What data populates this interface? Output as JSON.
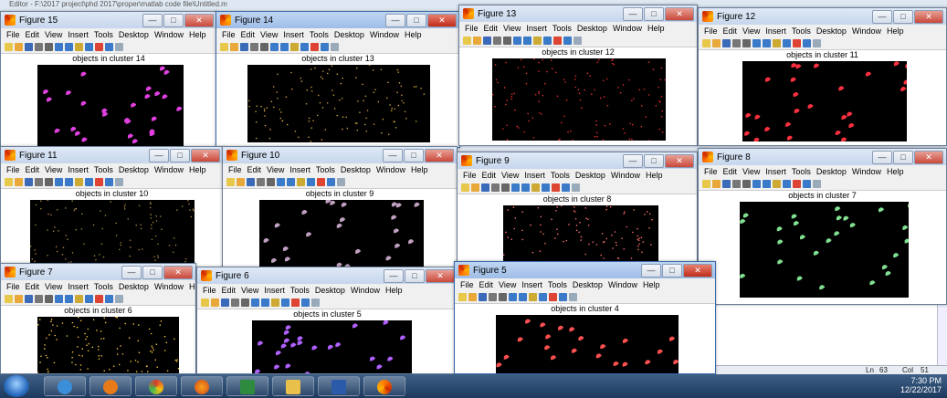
{
  "editor": {
    "title": "Editor - F:\\2017 project\\phd 2017\\proper\\matlab code file\\Untitled.m"
  },
  "menu": [
    "File",
    "Edit",
    "View",
    "Insert",
    "Tools",
    "Desktop",
    "Window",
    "Help"
  ],
  "figures": [
    {
      "title": "Figure 15",
      "plot_title": "objects in cluster 14",
      "dot": "#e040e0"
    },
    {
      "title": "Figure 14",
      "plot_title": "objects in cluster 13",
      "dot": "#c8a040"
    },
    {
      "title": "Figure 13",
      "plot_title": "objects in cluster 12",
      "dot": "#e03030"
    },
    {
      "title": "Figure 12",
      "plot_title": "objects in cluster 11",
      "dot": "#ff3040"
    },
    {
      "title": "Figure 11",
      "plot_title": "objects in cluster 10",
      "dot": "#a08040"
    },
    {
      "title": "Figure 10",
      "plot_title": "objects in cluster 9",
      "dot": "#c0a0c0"
    },
    {
      "title": "Figure 9",
      "plot_title": "objects in cluster 8",
      "dot": "#ff7070"
    },
    {
      "title": "Figure 8",
      "plot_title": "objects in cluster 7",
      "dot": "#80e090"
    },
    {
      "title": "Figure 7",
      "plot_title": "objects in cluster 6",
      "dot": "#f0c040"
    },
    {
      "title": "Figure 6",
      "plot_title": "objects in cluster 5",
      "dot": "#b060ff"
    },
    {
      "title": "Figure 5",
      "plot_title": "objects in cluster 4",
      "dot": "#ff5050"
    }
  ],
  "statusbar": {
    "ln_label": "Ln",
    "ln": "63",
    "col_label": "Col",
    "col": "51"
  },
  "tray": {
    "time": "7:30 PM",
    "date": "12/22/2017"
  },
  "colors": {
    "taskbar": "#1d3a5e",
    "titlebar": "#c6d6ec",
    "plot_bg": "#000000"
  }
}
